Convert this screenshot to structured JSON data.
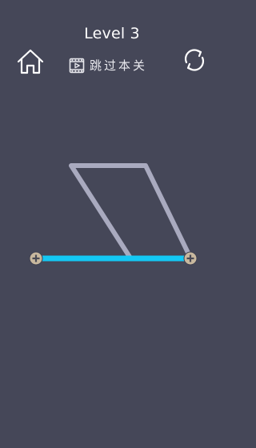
{
  "header": {
    "level_title": "Level 3",
    "home_icon": "home-icon",
    "restart_icon": "restart-icon"
  },
  "skip": {
    "icon": "video-icon",
    "label": "跳过本关"
  },
  "colors": {
    "background": "#454758",
    "puzzle_outline": "#a9aabf",
    "drawn_line": "#14c8f5",
    "anchor_fill": "#c8b89e",
    "anchor_cross": "#4a4a55"
  }
}
